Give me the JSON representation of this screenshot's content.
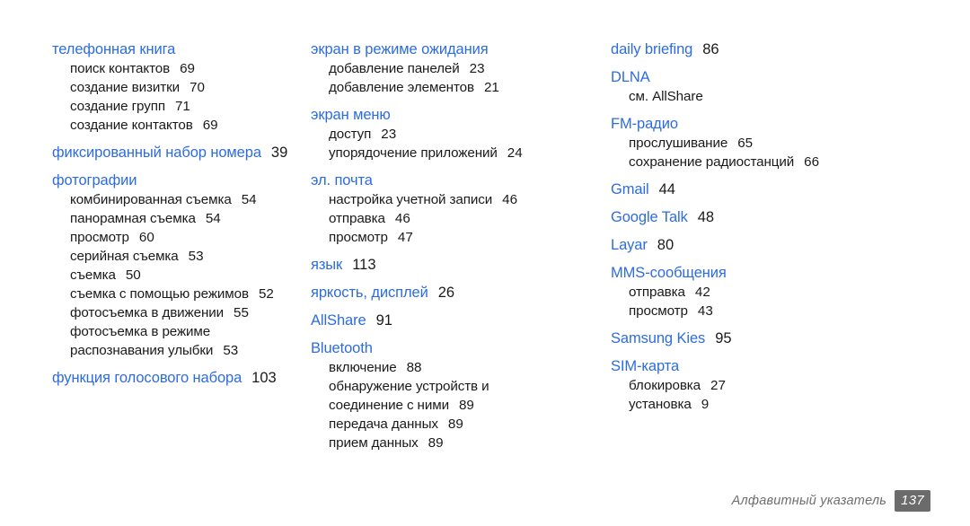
{
  "document": {
    "footer": {
      "label": "Алфавитный указатель",
      "page_number": "137"
    },
    "colors": {
      "heading_blue": "#2d6ce0",
      "body_text": "#1a1a1a",
      "footer_gray": "#6e6e6e",
      "badge_gray": "#6b6b6b",
      "background": "#ffffff"
    }
  },
  "columns": [
    {
      "id": "column-1",
      "entries": [
        {
          "heading": "телефонная книга",
          "page": "",
          "subentries": [
            {
              "label": "поиск контактов",
              "page": "69"
            },
            {
              "label": "создание визитки",
              "page": "70"
            },
            {
              "label": "создание групп",
              "page": "71"
            },
            {
              "label": "создание контактов",
              "page": "69"
            }
          ]
        },
        {
          "heading": "фиксированный набор номера",
          "page": "39",
          "subentries": []
        },
        {
          "heading": "фотографии",
          "page": "",
          "subentries": [
            {
              "label": "комбинированная съемка",
              "page": "54"
            },
            {
              "label": "панорамная съемка",
              "page": "54"
            },
            {
              "label": "просмотр",
              "page": "60"
            },
            {
              "label": "серийная съемка",
              "page": "53"
            },
            {
              "label": "съемка",
              "page": "50"
            },
            {
              "label": "съемка с помощью режимов",
              "page": "52"
            },
            {
              "label": "фотосъемка в движении",
              "page": "55"
            },
            {
              "label": "фотосъемка в режиме",
              "page": ""
            },
            {
              "label": "распознавания улыбки",
              "page": "53"
            }
          ]
        },
        {
          "heading": "функция голосового набора",
          "page": "103",
          "subentries": []
        }
      ]
    },
    {
      "id": "column-2",
      "entries": [
        {
          "heading": "экран в режиме ожидания",
          "page": "",
          "subentries": [
            {
              "label": "добавление панелей",
              "page": "23"
            },
            {
              "label": "добавление элементов",
              "page": "21"
            }
          ]
        },
        {
          "heading": "экран меню",
          "page": "",
          "subentries": [
            {
              "label": "доступ",
              "page": "23"
            },
            {
              "label": "упорядочение приложений",
              "page": "24"
            }
          ]
        },
        {
          "heading": "эл. почта",
          "page": "",
          "subentries": [
            {
              "label": "настройка учетной записи",
              "page": "46"
            },
            {
              "label": "отправка",
              "page": "46"
            },
            {
              "label": "просмотр",
              "page": "47"
            }
          ]
        },
        {
          "heading": "язык",
          "page": "113",
          "subentries": []
        },
        {
          "heading": "яркость, дисплей",
          "page": "26",
          "subentries": []
        },
        {
          "heading": "AllShare",
          "page": "91",
          "subentries": []
        },
        {
          "heading": "Bluetooth",
          "page": "",
          "subentries": [
            {
              "label": "включение",
              "page": "88"
            },
            {
              "label": "обнаружение устройств и",
              "page": ""
            },
            {
              "label": "соединение с ними",
              "page": "89"
            },
            {
              "label": "передача данных",
              "page": "89"
            },
            {
              "label": "прием данных",
              "page": "89"
            }
          ]
        }
      ]
    },
    {
      "id": "column-3",
      "entries": [
        {
          "heading": "daily briefing",
          "page": "86",
          "subentries": []
        },
        {
          "heading": "DLNA",
          "page": "",
          "subentries": [
            {
              "label": "см. AllShare",
              "page": ""
            }
          ]
        },
        {
          "heading": "FM-радио",
          "page": "",
          "subentries": [
            {
              "label": "прослушивание",
              "page": "65"
            },
            {
              "label": "сохранение радиостанций",
              "page": "66"
            }
          ]
        },
        {
          "heading": "Gmail",
          "page": "44",
          "subentries": []
        },
        {
          "heading": "Google Talk",
          "page": "48",
          "subentries": []
        },
        {
          "heading": "Layar",
          "page": "80",
          "subentries": []
        },
        {
          "heading": "MMS-сообщения",
          "page": "",
          "subentries": [
            {
              "label": "отправка",
              "page": "42"
            },
            {
              "label": "просмотр",
              "page": "43"
            }
          ]
        },
        {
          "heading": "Samsung Kies",
          "page": "95",
          "subentries": []
        },
        {
          "heading": "SIM-карта",
          "page": "",
          "subentries": [
            {
              "label": "блокировка",
              "page": "27"
            },
            {
              "label": "установка",
              "page": "9"
            }
          ]
        }
      ]
    }
  ]
}
